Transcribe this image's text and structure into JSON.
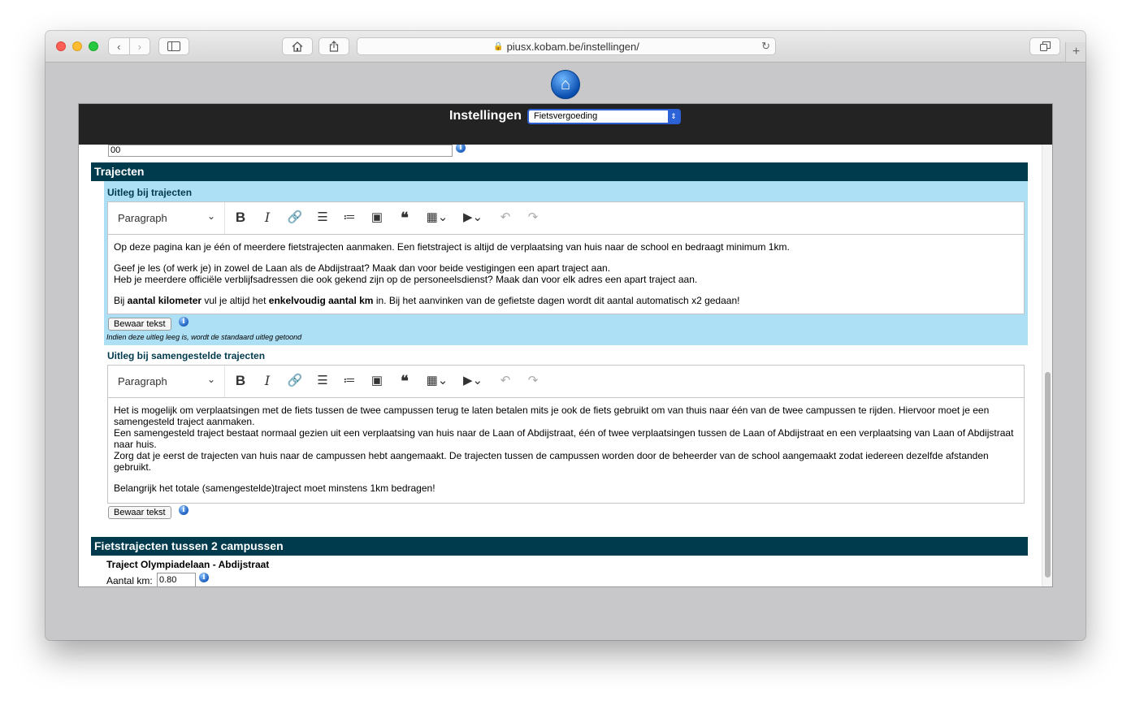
{
  "browser": {
    "url": "piusx.kobam.be/instellingen/"
  },
  "header": {
    "title": "Instellingen",
    "select_value": "Fietsvergoeding"
  },
  "top_field": {
    "value": "00"
  },
  "section_trajecten": {
    "title": "Trajecten",
    "uitleg": {
      "label": "Uitleg bij trajecten",
      "style_select": "Paragraph",
      "p1": "Op deze pagina kan je één of meerdere fietstrajecten aanmaken. Een fietstraject is altijd de verplaatsing van huis naar de school en bedraagt minimum 1km.",
      "p2a": "Geef je les (of werk je) in zowel de Laan als de Abdijstraat? Maak dan voor beide vestigingen een apart traject aan.",
      "p2b": "Heb je meerdere officiële verblijfsadressen die ook gekend zijn op de personeelsdienst? Maak dan voor elk adres een apart traject aan.",
      "p3_pre": "Bij ",
      "p3_b1": "aantal kilometer",
      "p3_mid": " vul je altijd het ",
      "p3_b2": "enkelvoudig aantal km",
      "p3_post": " in. Bij het aanvinken van de gefietste dagen wordt dit aantal automatisch x2 gedaan!",
      "save_label": "Bewaar tekst",
      "hint": "Indien deze uitleg leeg is, wordt de standaard uitleg getoond"
    },
    "samengesteld": {
      "label": "Uitleg bij samengestelde trajecten",
      "style_select": "Paragraph",
      "l1": "Het is mogelijk om verplaatsingen met de fiets tussen de twee campussen terug te laten betalen mits je ook de fiets gebruikt om van thuis naar één van de twee campussen te rijden. Hiervoor moet je een samengesteld traject aanmaken.",
      "l2": "Een samengesteld traject bestaat normaal gezien uit een verplaatsing van huis naar de Laan of Abdijstraat, één of twee verplaatsingen tussen de Laan of Abdijstraat en een verplaatsing van Laan of Abdijstraat naar huis.",
      "l3": "Zorg dat je eerst de trajecten van huis naar de campussen hebt aangemaakt. De trajecten tussen de campussen worden door de beheerder van de school aangemaakt zodat iedereen dezelfde afstanden gebruikt.",
      "p2": "Belangrijk het totale (samengestelde)traject moet minstens 1km bedragen!",
      "save_label": "Bewaar tekst"
    }
  },
  "section_campussen": {
    "title": "Fietstrajecten tussen 2 campussen",
    "traject_title": "Traject Olympiadelaan - Abdijstraat",
    "km_label": "Aantal km:",
    "km_value": "0.80"
  },
  "icons": {
    "info": "i",
    "home": "⌂"
  }
}
